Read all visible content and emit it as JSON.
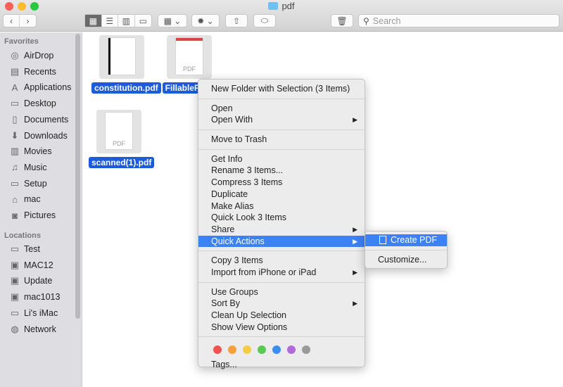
{
  "window": {
    "title": "pdf",
    "search_placeholder": "Search"
  },
  "sidebar": {
    "favorites_header": "Favorites",
    "favorites": [
      {
        "label": "AirDrop",
        "icon": "airdrop-icon",
        "glyph": "◎"
      },
      {
        "label": "Recents",
        "icon": "recents-icon",
        "glyph": "▤"
      },
      {
        "label": "Applications",
        "icon": "applications-icon",
        "glyph": "A"
      },
      {
        "label": "Desktop",
        "icon": "desktop-icon",
        "glyph": "▭"
      },
      {
        "label": "Documents",
        "icon": "documents-icon",
        "glyph": "▯"
      },
      {
        "label": "Downloads",
        "icon": "downloads-icon",
        "glyph": "⬇"
      },
      {
        "label": "Movies",
        "icon": "movies-icon",
        "glyph": "▥"
      },
      {
        "label": "Music",
        "icon": "music-icon",
        "glyph": "♫"
      },
      {
        "label": "Setup",
        "icon": "folder-icon",
        "glyph": "▭"
      },
      {
        "label": "mac",
        "icon": "home-icon",
        "glyph": "⌂"
      },
      {
        "label": "Pictures",
        "icon": "pictures-icon",
        "glyph": "◙"
      }
    ],
    "locations_header": "Locations",
    "locations": [
      {
        "label": "Test",
        "icon": "computer-icon",
        "glyph": "▭"
      },
      {
        "label": "MAC12",
        "icon": "disk-icon",
        "glyph": "▣"
      },
      {
        "label": "Update",
        "icon": "disk-icon",
        "glyph": "▣"
      },
      {
        "label": "mac1013",
        "icon": "disk-icon",
        "glyph": "▣"
      },
      {
        "label": "Li's iMac",
        "icon": "imac-icon",
        "glyph": "▭"
      },
      {
        "label": "Network",
        "icon": "network-icon",
        "glyph": "◍"
      }
    ]
  },
  "files": [
    {
      "name": "constitution.pdf",
      "badge": ""
    },
    {
      "name": "FillableFor",
      "badge": "PDF"
    },
    {
      "name": "scanned(1).pdf",
      "badge": "PDF"
    }
  ],
  "menu": {
    "groups": [
      [
        {
          "label": "New Folder with Selection (3 Items)"
        }
      ],
      [
        {
          "label": "Open"
        },
        {
          "label": "Open With",
          "submenu": true
        }
      ],
      [
        {
          "label": "Move to Trash"
        }
      ],
      [
        {
          "label": "Get Info"
        },
        {
          "label": "Rename 3 Items..."
        },
        {
          "label": "Compress 3 Items"
        },
        {
          "label": "Duplicate"
        },
        {
          "label": "Make Alias"
        },
        {
          "label": "Quick Look 3 Items"
        },
        {
          "label": "Share",
          "submenu": true
        },
        {
          "label": "Quick Actions",
          "submenu": true,
          "highlighted": true
        }
      ],
      [
        {
          "label": "Copy 3 Items"
        },
        {
          "label": "Import from iPhone or iPad",
          "submenu": true
        }
      ],
      [
        {
          "label": "Use Groups"
        },
        {
          "label": "Sort By",
          "submenu": true
        },
        {
          "label": "Clean Up Selection"
        },
        {
          "label": "Show View Options"
        }
      ]
    ],
    "tag_colors": [
      "#f0524f",
      "#f5a03c",
      "#f6cb46",
      "#5ac953",
      "#3a8ef6",
      "#b06bd8",
      "#9a9a9a"
    ],
    "tags_label": "Tags..."
  },
  "submenu": {
    "create_pdf": "Create PDF",
    "customize": "Customize..."
  }
}
